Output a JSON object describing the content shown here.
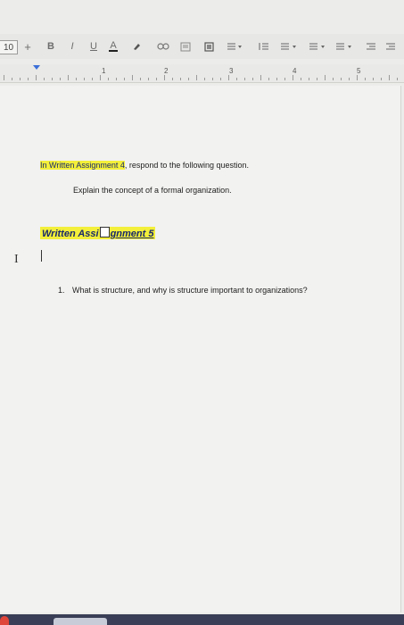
{
  "toolbar": {
    "font_size": "10",
    "plus_label": "+",
    "bold_label": "B",
    "italic_label": "I",
    "underline_label": "U",
    "text_color_label": "A"
  },
  "ruler": {
    "numbers": [
      "1",
      "2",
      "3",
      "4",
      "5"
    ]
  },
  "document": {
    "intro_prefix": "In Written Assignment 4",
    "intro_suffix": ", respond to the following question.",
    "prompt": "Explain the concept of a formal organization.",
    "heading_part1": "Written Assi",
    "heading_part2": "gnment 5",
    "question_number": "1.",
    "question_text": "What is structure, and why is structure important to organizations?"
  },
  "colors": {
    "highlight": "#f3ef3a",
    "heading_text": "#1a2a6a",
    "page_bg": "#f2f2f0"
  }
}
